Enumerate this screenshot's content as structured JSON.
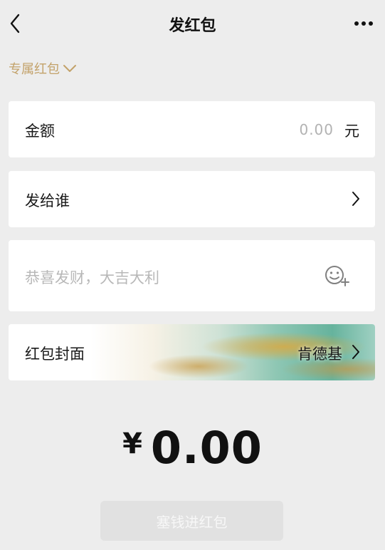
{
  "nav": {
    "title": "发红包",
    "back_icon": "chevron-left-icon",
    "more_icon": "more-dots-icon"
  },
  "packet_type": {
    "label": "专属红包",
    "icon": "chevron-down-icon",
    "color": "#c3a26a"
  },
  "amount": {
    "label": "金额",
    "placeholder": "0.00",
    "unit": "元"
  },
  "recipient": {
    "label": "发给谁",
    "icon": "chevron-right-icon"
  },
  "greeting": {
    "placeholder": "恭喜发财，大吉大利",
    "icon": "emoji-add-icon"
  },
  "cover": {
    "label": "红包封面",
    "name": "肯德基",
    "icon": "chevron-right-icon"
  },
  "total": {
    "currency": "¥",
    "value": "0.00"
  },
  "send_button": {
    "label": "塞钱进红包"
  },
  "colors": {
    "background": "#ededed",
    "card": "#ffffff",
    "accent_gold": "#c3a26a",
    "disabled_button": "#e1e1e1"
  }
}
